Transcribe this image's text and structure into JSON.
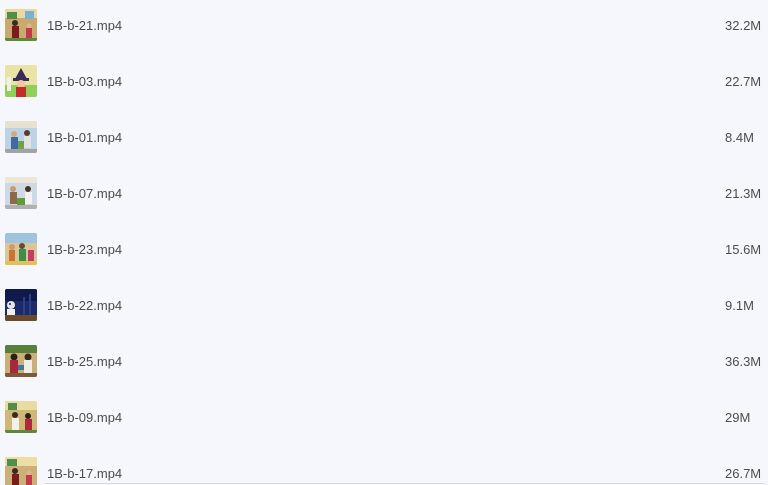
{
  "files": [
    {
      "name": "1B-b-21.mp4",
      "size": "32.2M",
      "thumbnail": "classroom-two-people-thumbnail"
    },
    {
      "name": "1B-b-03.mp4",
      "size": "22.7M",
      "thumbnail": "witch-hat-character-thumbnail"
    },
    {
      "name": "1B-b-01.mp4",
      "size": "8.4M",
      "thumbnail": "classroom-group-thumbnail"
    },
    {
      "name": "1B-b-07.mp4",
      "size": "21.3M",
      "thumbnail": "classroom-group-thumbnail"
    },
    {
      "name": "1B-b-23.mp4",
      "size": "15.6M",
      "thumbnail": "stage-characters-thumbnail"
    },
    {
      "name": "1B-b-22.mp4",
      "size": "9.1M",
      "thumbnail": "night-scene-thumbnail"
    },
    {
      "name": "1B-b-25.mp4",
      "size": "36.3M",
      "thumbnail": "two-people-talking-thumbnail"
    },
    {
      "name": "1B-b-09.mp4",
      "size": "29M",
      "thumbnail": "classroom-two-people-thumbnail"
    },
    {
      "name": "1B-b-17.mp4",
      "size": "26.7M",
      "thumbnail": "classroom-two-people-thumbnail"
    }
  ]
}
